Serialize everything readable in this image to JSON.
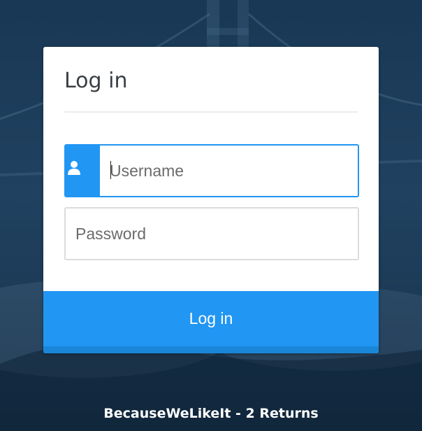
{
  "login_card": {
    "title": "Log in",
    "username": {
      "placeholder": "Username",
      "value": "",
      "icon": "user-icon"
    },
    "password": {
      "placeholder": "Password",
      "value": ""
    },
    "submit_label": "Log in"
  },
  "footer": {
    "text": "BecauseWeLikeIt - 2 Returns"
  },
  "colors": {
    "accent": "#2196f3",
    "accent_dark": "#1a86d8",
    "background": "#1d3d5c"
  }
}
